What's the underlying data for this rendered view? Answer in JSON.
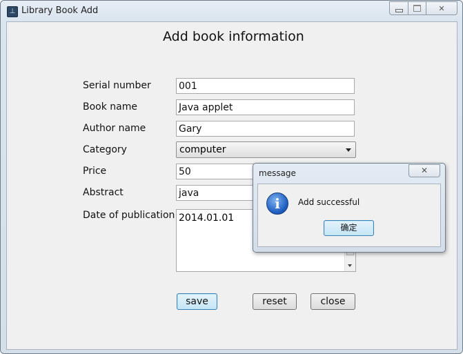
{
  "window": {
    "title": "Library Book Add",
    "icon": "app-icon-glyph",
    "controls": {
      "minimize": "minimize-icon",
      "maximize": "maximize-icon",
      "close": "✕"
    }
  },
  "form": {
    "heading": "Add book information",
    "fields": {
      "serial": {
        "label": "Serial number",
        "value": "001"
      },
      "book_name": {
        "label": "Book name",
        "value": "Java applet"
      },
      "author": {
        "label": "Author name",
        "value": "Gary"
      },
      "category": {
        "label": "Category",
        "value": "computer"
      },
      "price": {
        "label": "Price",
        "value": "50"
      },
      "abstract": {
        "label": "Abstract",
        "value": "java"
      },
      "date": {
        "label": "Date of publication",
        "value": "2014.01.01"
      }
    },
    "buttons": {
      "save": "save",
      "reset": "reset",
      "close": "close"
    }
  },
  "dialog": {
    "title": "message",
    "close": "✕",
    "icon": "info-icon",
    "message": "Add successful",
    "ok": "确定"
  },
  "colors": {
    "default_button": "#c4e5f6",
    "info_icon": "#1f5fc2"
  }
}
